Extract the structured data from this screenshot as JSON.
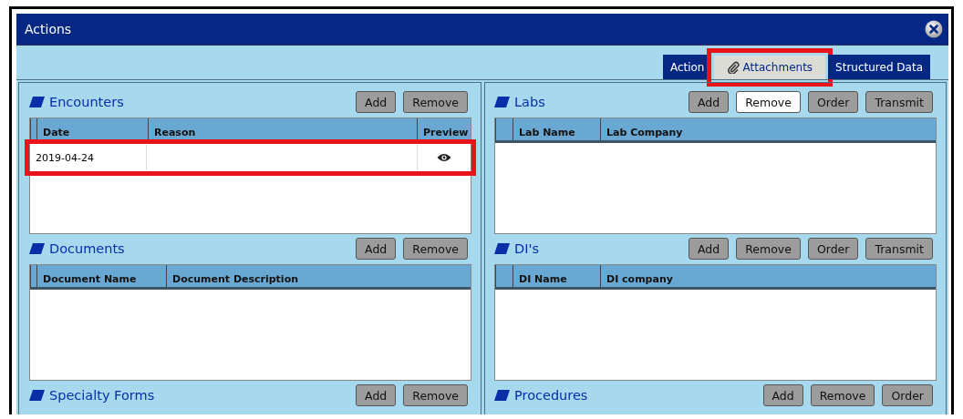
{
  "window": {
    "title": "Actions"
  },
  "tabs": [
    {
      "label": "Action",
      "selected": false,
      "highlighted": false,
      "kind": "plain"
    },
    {
      "label": "Attachments",
      "selected": true,
      "highlighted": true,
      "kind": "attachment"
    },
    {
      "label": "Structured Data",
      "selected": false,
      "highlighted": false,
      "kind": "plain"
    }
  ],
  "columns": [
    [
      {
        "title": "Encounters",
        "buttons": [
          {
            "label": "Add",
            "active": false
          },
          {
            "label": "Remove",
            "active": false
          }
        ],
        "table": {
          "columns": [
            "Date",
            "Reason",
            "Preview"
          ],
          "rows": [
            {
              "date": "2019-04-24",
              "preview": true,
              "highlighted": true
            }
          ]
        }
      },
      {
        "title": "Documents",
        "buttons": [
          {
            "label": "Add",
            "active": false
          },
          {
            "label": "Remove",
            "active": false
          }
        ],
        "table": {
          "columns": [
            "Document Name",
            "Document Description"
          ]
        }
      },
      {
        "title": "Specialty Forms",
        "buttons": [
          {
            "label": "Add",
            "active": false
          },
          {
            "label": "Remove",
            "active": false
          }
        ]
      }
    ],
    [
      {
        "title": "Labs",
        "buttons": [
          {
            "label": "Add",
            "active": false
          },
          {
            "label": "Remove",
            "active": true
          },
          {
            "label": "Order",
            "active": false
          },
          {
            "label": "Transmit",
            "active": false
          }
        ],
        "table": {
          "columns": [
            "Lab Name",
            "Lab Company"
          ]
        }
      },
      {
        "title": "DI's",
        "buttons": [
          {
            "label": "Add",
            "active": false
          },
          {
            "label": "Remove",
            "active": false
          },
          {
            "label": "Order",
            "active": false
          },
          {
            "label": "Transmit",
            "active": false
          }
        ],
        "table": {
          "columns": [
            "DI Name",
            "DI company"
          ]
        }
      },
      {
        "title": "Procedures",
        "buttons": [
          {
            "label": "Add",
            "active": false
          },
          {
            "label": "Remove",
            "active": false
          },
          {
            "label": "Order",
            "active": false
          }
        ]
      }
    ]
  ]
}
